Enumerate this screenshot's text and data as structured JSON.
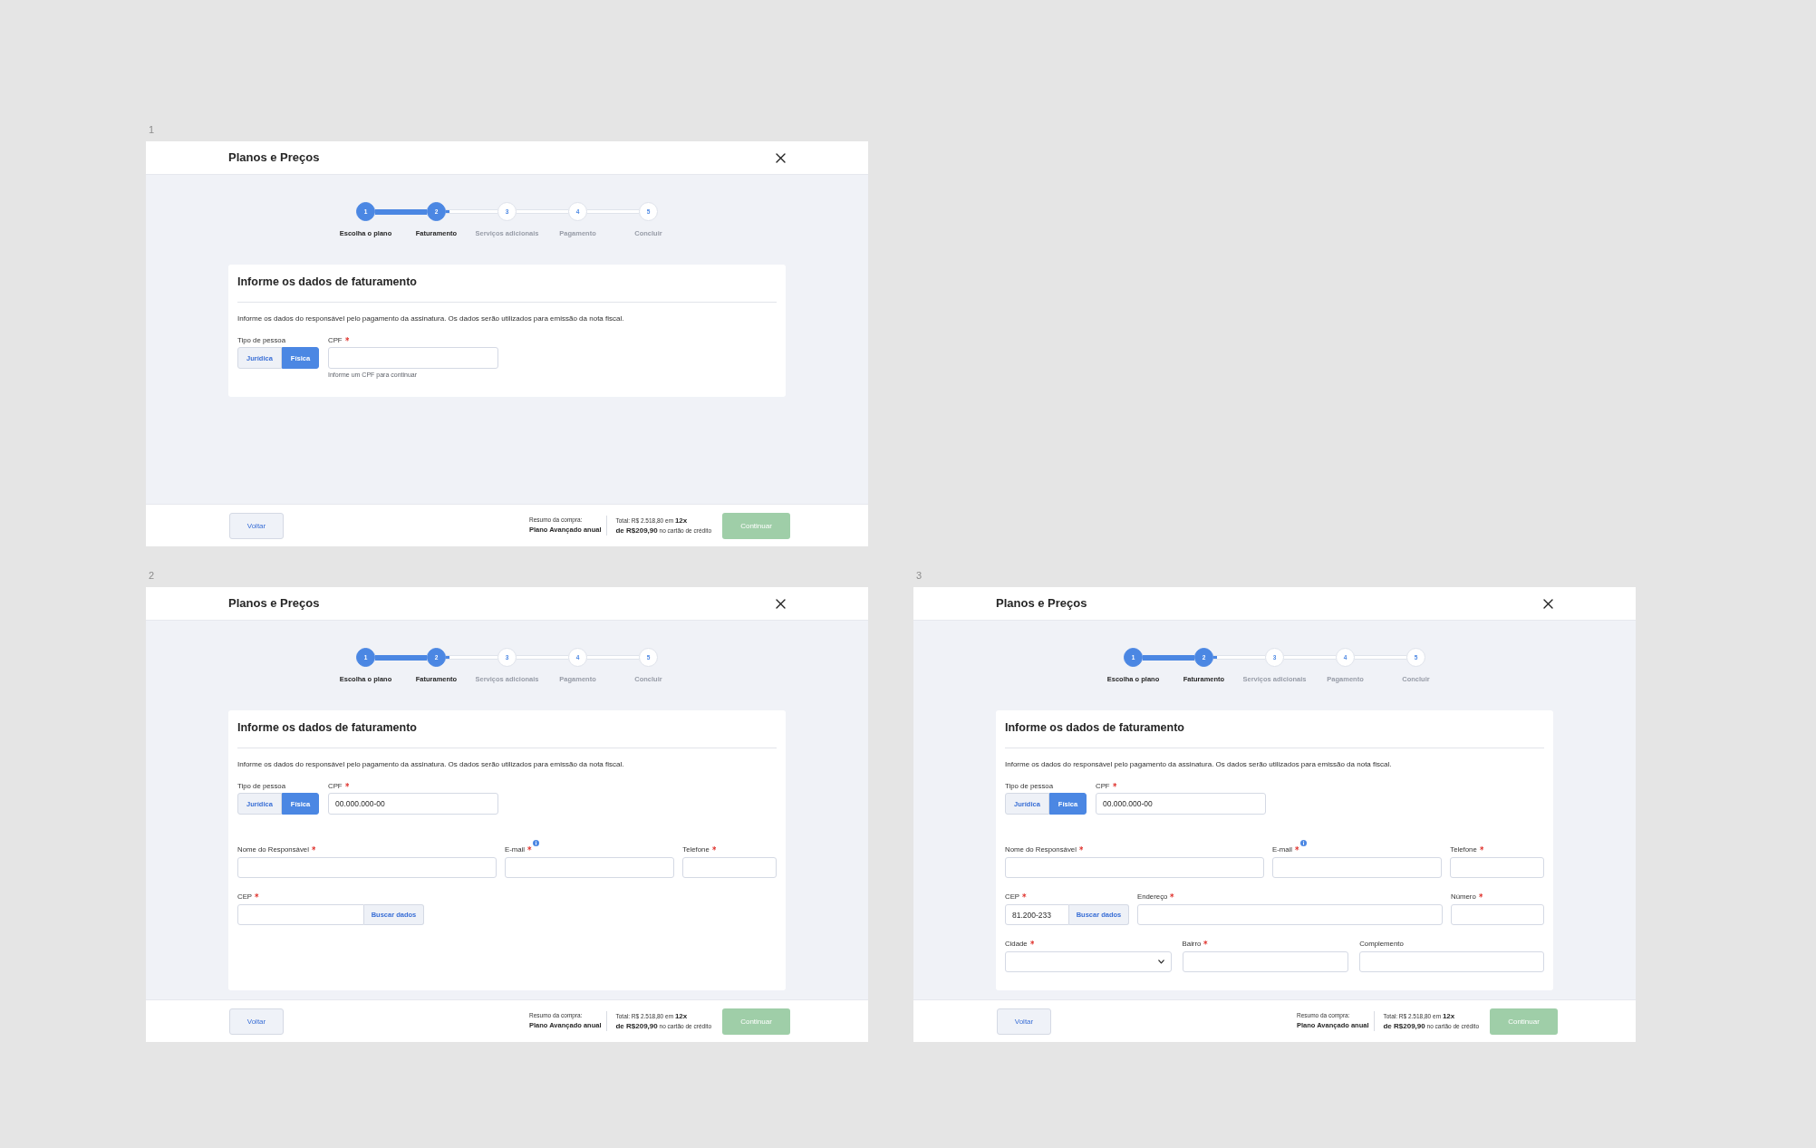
{
  "frames": [
    {
      "number": "1",
      "title": "Planos e Preços",
      "steps": [
        {
          "number": "1",
          "label": "Escolha o plano",
          "active": true
        },
        {
          "number": "2",
          "label": "Faturamento",
          "active": true
        },
        {
          "number": "3",
          "label": "Serviços adicionais",
          "active": false
        },
        {
          "number": "4",
          "label": "Pagamento",
          "active": false
        },
        {
          "number": "5",
          "label": "Concluir",
          "active": false
        }
      ],
      "card": {
        "title": "Informe os dados de faturamento",
        "description": "Informe os dados do responsável pelo pagamento da assinatura. Os dados serão utilizados para emissão da nota fiscal.",
        "person_type": {
          "label": "Tipo de pessoa",
          "options": [
            {
              "label": "Jurídica",
              "selected": false
            },
            {
              "label": "Física",
              "selected": true
            }
          ]
        },
        "cpf": {
          "label": "CPF",
          "required": true,
          "info": false,
          "hint": "Informe um CPF para continuar"
        }
      },
      "footer": {
        "back_button": "Voltar",
        "summary_label": "Resumo da compra:",
        "plan": "Plano Avançado anual",
        "total_line": "Total: R$ 2.518,80 em **12x**",
        "installment_line": "**de R$209,90** no cartão de crédito",
        "continue_button": {
          "label": "Continuar",
          "disabled": true
        }
      }
    },
    {
      "number": "2",
      "title": "Planos e Preços",
      "steps": [
        {
          "number": "1",
          "label": "Escolha o plano",
          "active": true
        },
        {
          "number": "2",
          "label": "Faturamento",
          "active": true
        },
        {
          "number": "3",
          "label": "Serviços adicionais",
          "active": false
        },
        {
          "number": "4",
          "label": "Pagamento",
          "active": false
        },
        {
          "number": "5",
          "label": "Concluir",
          "active": false
        }
      ],
      "card": {
        "title": "Informe os dados de faturamento",
        "description": "Informe os dados do responsável pelo pagamento da assinatura. Os dados serão utilizados para emissão da nota fiscal.",
        "person_type": {
          "label": "Tipo de pessoa",
          "options": [
            {
              "label": "Jurídica",
              "selected": false
            },
            {
              "label": "Física",
              "selected": true
            }
          ]
        },
        "cpf": {
          "label": "CPF",
          "required": true,
          "info": false,
          "value": "00.000.000-00"
        },
        "rows": [
          [
            {
              "kind": "text",
              "label": "Nome do Responsável",
              "required": true,
              "info": false
            },
            {
              "kind": "text",
              "label": "E-mail",
              "required": true,
              "info": true
            },
            {
              "kind": "text",
              "label": "Telefone",
              "required": true,
              "info": false
            }
          ],
          [
            {
              "kind": "cep",
              "label": "CEP",
              "required": true,
              "info": false,
              "button": "Buscar dados"
            }
          ]
        ]
      },
      "footer": {
        "back_button": "Voltar",
        "summary_label": "Resumo da compra:",
        "plan": "Plano Avançado anual",
        "total_line": "Total: R$ 2.518,80 em **12x**",
        "installment_line": "**de R$209,90** no cartão de crédito",
        "continue_button": {
          "label": "Continuar",
          "disabled": true
        }
      }
    },
    {
      "number": "3",
      "title": "Planos e Preços",
      "steps": [
        {
          "number": "1",
          "label": "Escolha o plano",
          "active": true
        },
        {
          "number": "2",
          "label": "Faturamento",
          "active": true
        },
        {
          "number": "3",
          "label": "Serviços adicionais",
          "active": false
        },
        {
          "number": "4",
          "label": "Pagamento",
          "active": false
        },
        {
          "number": "5",
          "label": "Concluir",
          "active": false
        }
      ],
      "card": {
        "title": "Informe os dados de faturamento",
        "description": "Informe os dados do responsável pelo pagamento da assinatura. Os dados serão utilizados para emissão da nota fiscal.",
        "person_type": {
          "label": "Tipo de pessoa",
          "options": [
            {
              "label": "Jurídica",
              "selected": false
            },
            {
              "label": "Física",
              "selected": true
            }
          ]
        },
        "cpf": {
          "label": "CPF",
          "required": true,
          "info": false,
          "value": "00.000.000-00"
        },
        "rows": [
          [
            {
              "kind": "text",
              "label": "Nome do Responsável",
              "required": true,
              "info": false
            },
            {
              "kind": "text",
              "label": "E-mail",
              "required": true,
              "info": true
            },
            {
              "kind": "text",
              "label": "Telefone",
              "required": true,
              "info": false
            }
          ],
          [
            {
              "kind": "cep",
              "label": "CEP",
              "required": true,
              "info": false,
              "value": "81.200-233",
              "button": "Buscar dados"
            },
            {
              "kind": "text",
              "label": "Endereço",
              "required": true,
              "info": false
            },
            {
              "kind": "text",
              "label": "Número",
              "required": true,
              "info": false
            }
          ],
          [
            {
              "kind": "select",
              "label": "Cidade",
              "required": true,
              "info": false
            },
            {
              "kind": "text",
              "label": "Bairro",
              "required": true,
              "info": false
            },
            {
              "kind": "text",
              "label": "Complemento",
              "required": false,
              "info": false
            }
          ]
        ]
      },
      "footer": {
        "back_button": "Voltar",
        "summary_label": "Resumo da compra:",
        "plan": "Plano Avançado anual",
        "total_line": "Total: R$ 2.518,80 em **12x**",
        "installment_line": "**de R$209,90** no cartão de crédito",
        "continue_button": {
          "label": "Continuar",
          "disabled": true
        }
      }
    }
  ]
}
